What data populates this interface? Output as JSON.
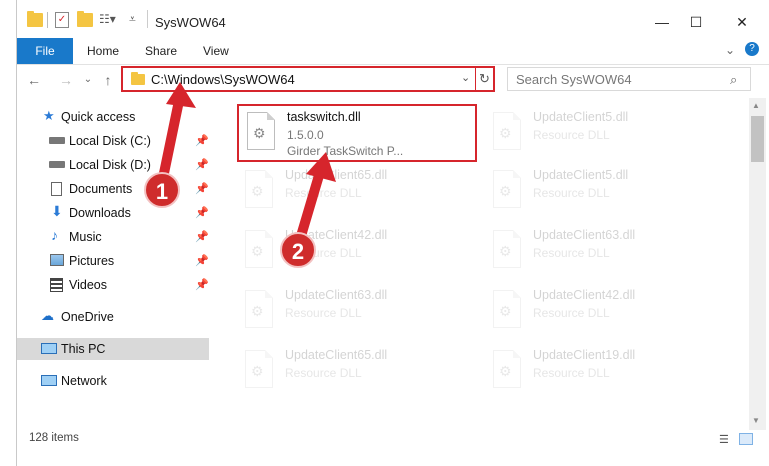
{
  "window": {
    "title": "SysWOW64"
  },
  "ribbon": {
    "tabs": [
      "File",
      "Home",
      "Share",
      "View"
    ],
    "help_icon": "?"
  },
  "address": {
    "path": "C:\\Windows\\SysWOW64"
  },
  "search": {
    "placeholder": "Search SysWOW64"
  },
  "sidebar": {
    "items": [
      {
        "label": "Quick access",
        "icon": "star-icon"
      },
      {
        "label": "Local Disk (C:)",
        "icon": "drive-icon",
        "pinned": true
      },
      {
        "label": "Local Disk (D:)",
        "icon": "drive-icon",
        "pinned": true
      },
      {
        "label": "Documents",
        "icon": "documents-icon",
        "pinned": true
      },
      {
        "label": "Downloads",
        "icon": "download-icon",
        "pinned": true
      },
      {
        "label": "Music",
        "icon": "music-icon",
        "pinned": true
      },
      {
        "label": "Pictures",
        "icon": "pictures-icon",
        "pinned": true
      },
      {
        "label": "Videos",
        "icon": "videos-icon",
        "pinned": true
      },
      {
        "label": "OneDrive",
        "icon": "cloud-icon"
      },
      {
        "label": "This PC",
        "icon": "computer-icon",
        "selected": true
      },
      {
        "label": "Network",
        "icon": "network-icon"
      }
    ]
  },
  "files": [
    {
      "name": "taskswitch.dll",
      "line2": "1.5.0.0",
      "line3": "Girder TaskSwitch P..."
    },
    {
      "name": "UpdateClient5.dll",
      "line2": "Resource DLL"
    },
    {
      "name": "UpdateClient65.dll",
      "line2": "Resource DLL"
    },
    {
      "name": "UpdateClient5.dll",
      "line2": "Resource DLL"
    },
    {
      "name": "UpdateClient42.dll",
      "line2": "Resource DLL"
    },
    {
      "name": "UpdateClient63.dll",
      "line2": "Resource DLL"
    },
    {
      "name": "UpdateClient63.dll",
      "line2": "Resource DLL"
    },
    {
      "name": "UpdateClient42.dll",
      "line2": "Resource DLL"
    },
    {
      "name": "UpdateClient65.dll",
      "line2": "Resource DLL"
    },
    {
      "name": "UpdateClient19.dll",
      "line2": "Resource DLL"
    }
  ],
  "status": {
    "item_count": "128 items"
  },
  "annotations": {
    "badge1": "1",
    "badge2": "2"
  },
  "colors": {
    "accent": "#1979ca",
    "annotation_red": "#d6252c"
  }
}
